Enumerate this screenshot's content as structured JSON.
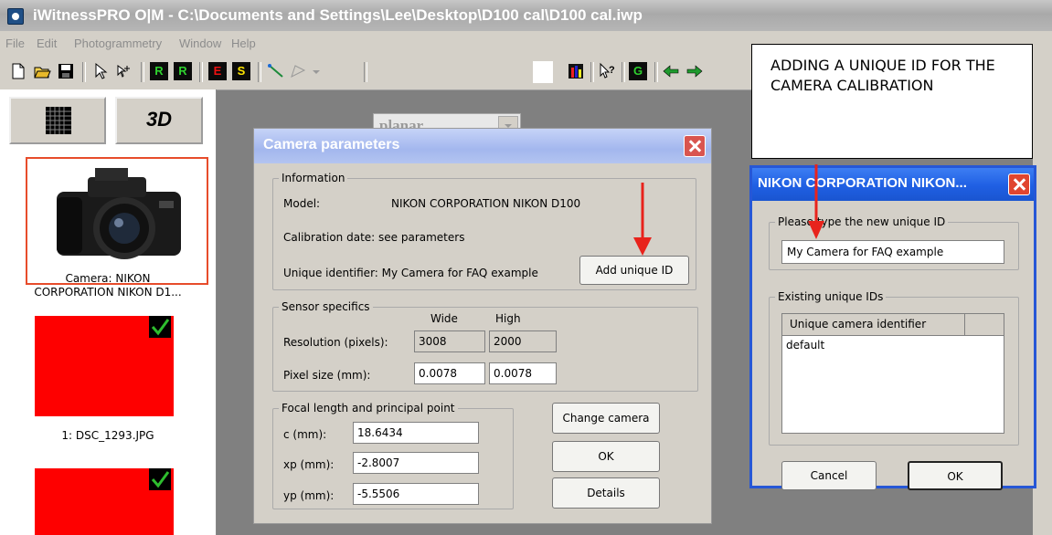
{
  "window": {
    "title": "iWitnessPRO O|M - C:\\Documents and Settings\\Lee\\Desktop\\D100 cal\\D100 cal.iwp"
  },
  "menu": [
    "File",
    "Edit",
    "Photogrammetry",
    "Window",
    "Help"
  ],
  "toolbar": {
    "r_icon": "R",
    "r2_icon": "R",
    "e_icon": "E",
    "s_icon": "S",
    "g_icon": "G",
    "mode_value": "planar"
  },
  "left_panel": {
    "button_3d": "3D",
    "camera_caption_line1": "Camera: NIKON",
    "camera_caption_line2": "CORPORATION NIKON D1...",
    "image1_caption": "1: DSC_1293.JPG"
  },
  "camera_dialog": {
    "title": "Camera parameters",
    "information_legend": "Information",
    "model_label": "Model:",
    "model_value": "NIKON CORPORATION NIKON D100",
    "calibration_date": "Calibration date: see parameters",
    "unique_identifier": "Unique identifier: My Camera for FAQ example",
    "add_unique_id_button": "Add unique ID",
    "sensor_legend": "Sensor specifics",
    "wide_header": "Wide",
    "high_header": "High",
    "resolution_label": "Resolution (pixels):",
    "resolution_wide": "3008",
    "resolution_high": "2000",
    "pixel_size_label": "Pixel size (mm):",
    "pixel_size_wide": "0.0078",
    "pixel_size_high": "0.0078",
    "focal_legend": "Focal length and principal point",
    "c_label": "c (mm):",
    "c_value": "18.6434",
    "xp_label": "xp (mm):",
    "xp_value": "-2.8007",
    "yp_label": "yp (mm):",
    "yp_value": "-5.5506",
    "change_camera_button": "Change camera",
    "ok_button": "OK",
    "details_button": "Details"
  },
  "unique_id_dialog": {
    "title": "NIKON CORPORATION NIKON...",
    "new_id_legend": "Please type the new unique ID",
    "new_id_value": "My Camera for FAQ example",
    "existing_legend": "Existing unique IDs",
    "column_header": "Unique camera identifier",
    "items": [
      "default"
    ],
    "cancel_button": "Cancel",
    "ok_button": "OK"
  },
  "annotation": {
    "text": "ADDING A UNIQUE ID FOR THE CAMERA CALIBRATION"
  },
  "colors": {
    "accent_red_arrow": "#e8231c",
    "dialog_blue": "#2657d6",
    "selection_border": "#e74c2b",
    "image_placeholder": "#fe0000",
    "check_green": "#2ebd2e"
  }
}
